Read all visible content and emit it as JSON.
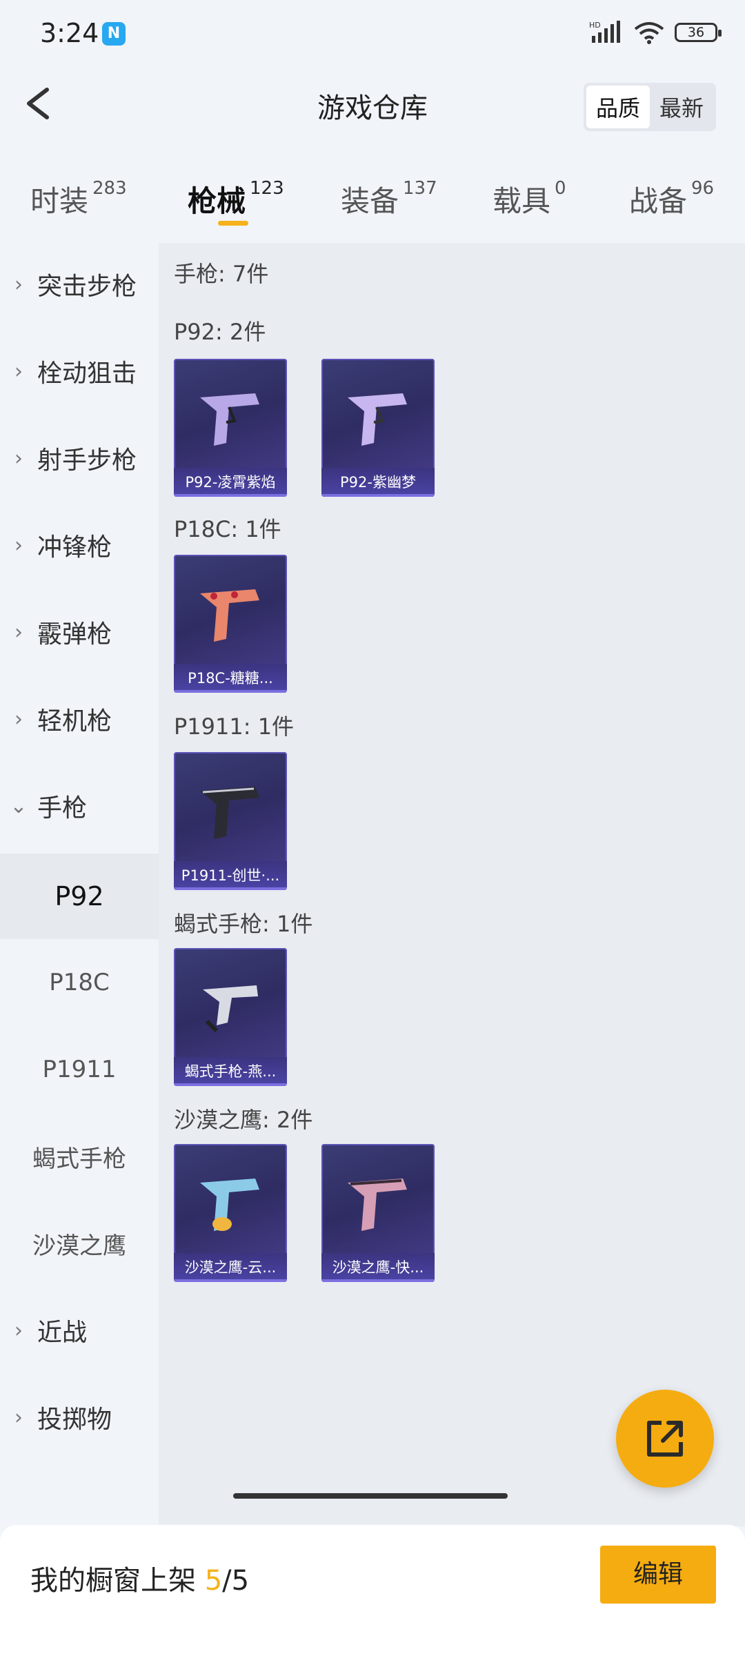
{
  "status": {
    "time": "3:24",
    "nfc": "N",
    "battery": "36"
  },
  "header": {
    "title": "游戏仓库",
    "sort_options": [
      "品质",
      "最新"
    ]
  },
  "tabs": [
    {
      "label": "时装",
      "count": "283"
    },
    {
      "label": "枪械",
      "count": "123"
    },
    {
      "label": "装备",
      "count": "137"
    },
    {
      "label": "载具",
      "count": "0"
    },
    {
      "label": "战备",
      "count": "96"
    }
  ],
  "sidebar": {
    "categories": [
      "突击步枪",
      "栓动狙击",
      "射手步枪",
      "冲锋枪",
      "霰弹枪",
      "轻机枪",
      "手枪"
    ],
    "pistol_subs": [
      "P92",
      "P18C",
      "P1911",
      "蝎式手枪",
      "沙漠之鹰"
    ],
    "more": [
      "近战",
      "投掷物"
    ]
  },
  "content": {
    "summary": "手枪: 7件",
    "groups": [
      {
        "title": "P92: 2件",
        "items": [
          "P92-凌霄紫焰",
          "P92-紫幽梦"
        ]
      },
      {
        "title": "P18C: 1件",
        "items": [
          "P18C-糖糖..."
        ]
      },
      {
        "title": "P1911: 1件",
        "items": [
          "P1911-创世·..."
        ]
      },
      {
        "title": "蝎式手枪: 1件",
        "items": [
          "蝎式手枪-燕..."
        ]
      },
      {
        "title": "沙漠之鹰: 2件",
        "items": [
          "沙漠之鹰-云...",
          "沙漠之鹰-快..."
        ]
      }
    ]
  },
  "bottom": {
    "label": "我的橱窗上架",
    "current": "5",
    "total": "/5",
    "edit_label": "编辑"
  },
  "colors": {
    "accent": "#f5ac10",
    "card_bg": "#2f2c63"
  }
}
